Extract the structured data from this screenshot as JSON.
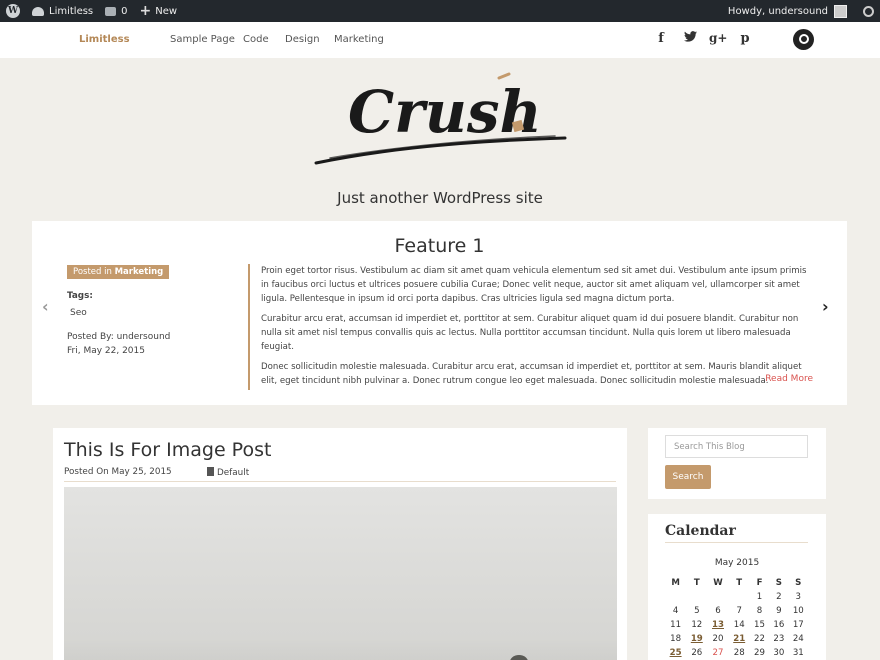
{
  "admin_bar": {
    "site_name": "Limitless",
    "comments_count": "0",
    "new_label": "New",
    "greeting": "Howdy, undersound"
  },
  "nav": {
    "brand": "Limitless",
    "links": [
      "Sample Page",
      "Code",
      "Design",
      "Marketing"
    ],
    "social_icons": [
      "facebook-icon",
      "twitter-icon",
      "google-plus-icon",
      "pinterest-icon"
    ]
  },
  "header": {
    "logo_text": "Crush",
    "tagline": "Just another WordPress site"
  },
  "feature": {
    "title": "Feature 1",
    "posted_in_label": "Posted in",
    "category": "Marketing",
    "tags_label": "Tags:",
    "tag": "Seo",
    "posted_by": "Posted By: undersound",
    "date": "Fri, May 22, 2015",
    "paragraphs": [
      "Proin eget tortor risus. Vestibulum ac diam sit amet quam vehicula elementum sed sit amet dui. Vestibulum ante ipsum primis in faucibus orci luctus et ultrices posuere cubilia Curae; Donec velit neque, auctor sit amet aliquam vel, ullamcorper sit amet ligula. Pellentesque in ipsum id orci porta dapibus. Cras ultricies ligula sed magna dictum porta.",
      "Curabitur arcu erat, accumsan id imperdiet et, porttitor at sem. Curabitur aliquet quam id dui posuere blandit. Curabitur non nulla sit amet nisl tempus convallis quis ac lectus. Nulla porttitor accumsan tincidunt. Nulla quis lorem ut libero malesuada feugiat.",
      "Donec sollicitudin molestie malesuada. Curabitur arcu erat, accumsan id imperdiet et, porttitor at sem. Mauris blandit aliquet elit, eget tincidunt nibh pulvinar a. Donec rutrum congue leo eget malesuada. Donec sollicitudin molestie malesuada."
    ],
    "read_more": "Read More"
  },
  "post": {
    "title": "This Is For Image Post",
    "posted_on": "Posted On May 25, 2015",
    "format": "Default"
  },
  "sidebar": {
    "search_placeholder": "Search This Blog",
    "search_button": "Search",
    "calendar_title": "Calendar",
    "calendar_month": "May 2015",
    "weekdays": [
      "M",
      "T",
      "W",
      "T",
      "F",
      "S",
      "S"
    ],
    "weeks": [
      [
        "",
        "",
        "",
        "",
        "1",
        "2",
        "3"
      ],
      [
        "4",
        "5",
        "6",
        "7",
        "8",
        "9",
        "10"
      ],
      [
        "11",
        "12",
        "13",
        "14",
        "15",
        "16",
        "17"
      ],
      [
        "18",
        "19",
        "20",
        "21",
        "22",
        "23",
        "24"
      ],
      [
        "25",
        "26",
        "27",
        "28",
        "29",
        "30",
        "31"
      ]
    ],
    "linked_days": [
      "13",
      "19",
      "21",
      "25"
    ],
    "today": "27"
  },
  "colors": {
    "accent": "#c49a6c",
    "admin_bar": "#23282d",
    "read_more": "#d9534f"
  }
}
